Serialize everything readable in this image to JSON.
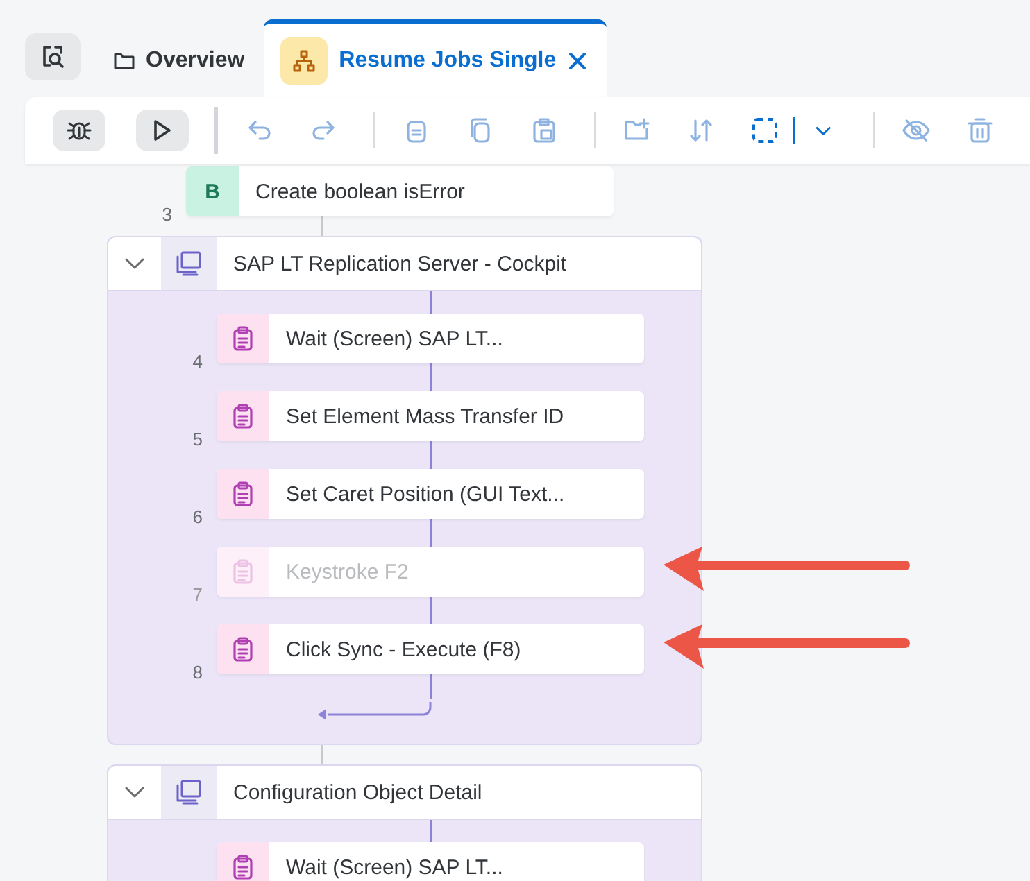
{
  "tabs": [
    {
      "kind": "folder",
      "label": "Overview",
      "selected": false,
      "closable": false
    },
    {
      "kind": "flow",
      "label": "Resume Jobs Single",
      "selected": true,
      "closable": true
    }
  ],
  "flow": [
    {
      "kind": "variable",
      "number": "3",
      "label": "Create boolean isError",
      "badge": "B",
      "disabled": false,
      "marked": false
    },
    {
      "kind": "group",
      "title": "SAP LT Replication Server - Cockpit",
      "expanded": true,
      "children": [
        {
          "kind": "action",
          "number": "4",
          "label": "Wait (Screen) SAP LT...",
          "disabled": false,
          "marked": false
        },
        {
          "kind": "action",
          "number": "5",
          "label": "Set Element Mass Transfer ID",
          "disabled": false,
          "marked": false
        },
        {
          "kind": "action",
          "number": "6",
          "label": "Set Caret Position (GUI Text...",
          "disabled": false,
          "marked": false
        },
        {
          "kind": "action",
          "number": "7",
          "label": "Keystroke F2",
          "disabled": true,
          "marked": true
        },
        {
          "kind": "action",
          "number": "8",
          "label": "Click Sync - Execute (F8)",
          "disabled": false,
          "marked": true
        }
      ]
    },
    {
      "kind": "group",
      "title": "Configuration Object Detail",
      "expanded": true,
      "children": [
        {
          "kind": "action",
          "label": "Wait (Screen) SAP LT...",
          "disabled": false,
          "marked": false
        }
      ]
    }
  ]
}
